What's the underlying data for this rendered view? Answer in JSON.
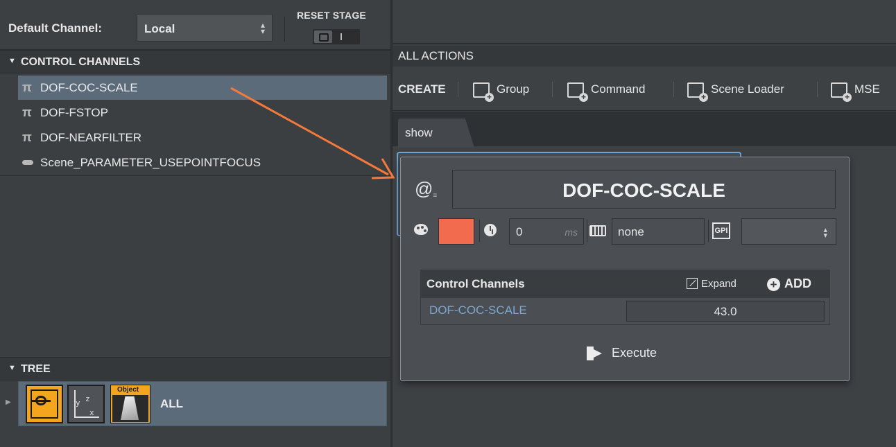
{
  "left_panel": {
    "default_channel_label": "Default Channel:",
    "default_channel_value": "Local",
    "reset_stage_label": "RESET STAGE",
    "control_channels_header": "CONTROL CHANNELS",
    "control_channels": [
      {
        "label": "DOF-COC-SCALE",
        "icon": "pi-icon",
        "selected": true
      },
      {
        "label": "DOF-FSTOP",
        "icon": "pi-icon",
        "selected": false
      },
      {
        "label": "DOF-NEARFILTER",
        "icon": "pi-icon",
        "selected": false
      },
      {
        "label": "Scene_PARAMETER_USEPOINTFOCUS",
        "icon": "toggle-icon",
        "selected": false
      }
    ],
    "tree_header": "TREE",
    "tree_item": {
      "label": "ALL",
      "object_tile_label": "Object",
      "axis_labels": {
        "y": "y",
        "z": "z",
        "x": "x"
      }
    }
  },
  "right_panel": {
    "all_actions_label": "ALL ACTIONS",
    "create_label": "CREATE",
    "create_items": [
      {
        "label": "Group",
        "icon": "group-add-icon"
      },
      {
        "label": "Command",
        "icon": "command-add-icon"
      },
      {
        "label": "Scene Loader",
        "icon": "scene-loader-add-icon"
      },
      {
        "label": "MSE",
        "icon": "mse-add-icon"
      }
    ],
    "tabs": [
      {
        "label": "show"
      }
    ]
  },
  "popup": {
    "title": "DOF-COC-SCALE",
    "at_symbol": "@",
    "at_sub": "≡",
    "color": "#f26b4e",
    "delay_value": "0",
    "delay_unit": "ms",
    "shortcut_value": "none",
    "gpi_label": "GPI",
    "gpi_value": "",
    "table_header": "Control Channels",
    "expand_label": "Expand",
    "add_label": "ADD",
    "rows": [
      {
        "name": "DOF-COC-SCALE",
        "value": "43.0"
      }
    ],
    "execute_label": "Execute"
  },
  "colors": {
    "selection": "#5c6b7a",
    "accent_orange": "#f47a3b",
    "highlight_border": "#6fa6d6",
    "link_blue": "#7ca7cf"
  }
}
